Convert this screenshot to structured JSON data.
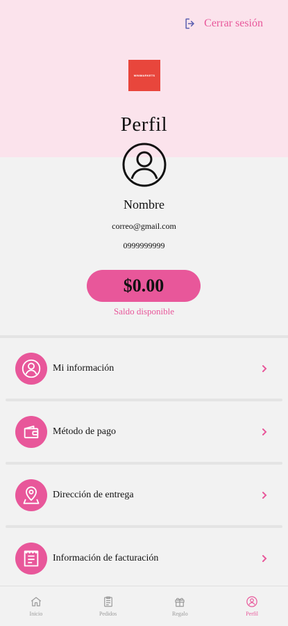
{
  "header": {
    "logout_label": "Cerrar sesión",
    "logo_text": "MINIMARKETS",
    "title": "Perfil"
  },
  "profile": {
    "name": "Nombre",
    "email": "correo@gmail.com",
    "phone": "0999999999",
    "balance": "$0.00",
    "balance_label": "Saldo disponible"
  },
  "menu": [
    {
      "label": "Mi información",
      "icon": "user-icon"
    },
    {
      "label": "Método de pago",
      "icon": "wallet-icon"
    },
    {
      "label": "Dirección de entrega",
      "icon": "location-pin-icon"
    },
    {
      "label": "Información de facturación",
      "icon": "invoice-icon"
    }
  ],
  "nav": [
    {
      "label": "Inicio",
      "icon": "home-icon",
      "active": false
    },
    {
      "label": "Pedidos",
      "icon": "orders-icon",
      "active": false
    },
    {
      "label": "Regalo",
      "icon": "gift-icon",
      "active": false
    },
    {
      "label": "Perfil",
      "icon": "profile-icon",
      "active": true
    }
  ],
  "colors": {
    "accent": "#e8579a",
    "header_bg": "#fbe3ec",
    "logo_bg": "#e8463c",
    "page_bg": "#f2f2f2"
  }
}
